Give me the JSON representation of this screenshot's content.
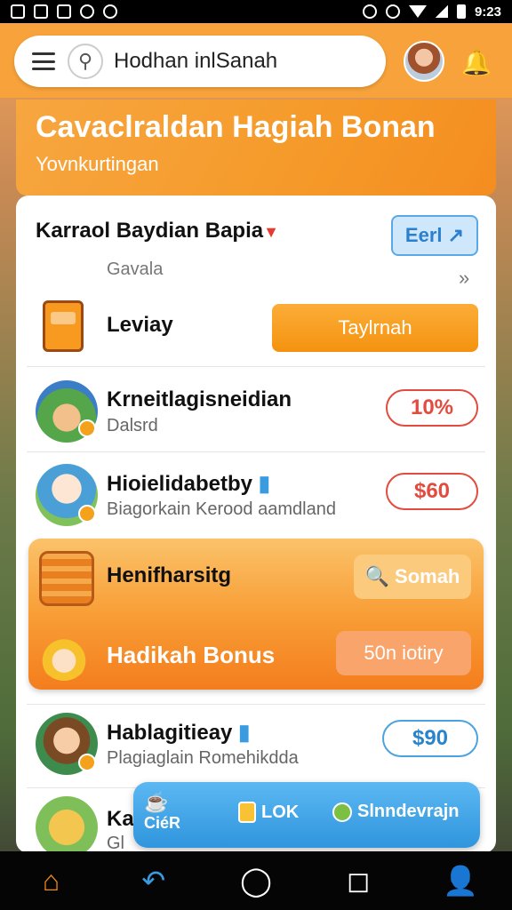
{
  "status_bar": {
    "time": "9:23"
  },
  "header": {
    "search_text": "Hodhan inlSanah"
  },
  "banner": {
    "title": "Cavaclraldan Hagiah Bonan",
    "subtitle": "Yovnkurtingan"
  },
  "card": {
    "title": "Karraol Baydian Bapia",
    "earn_label": "Eerl",
    "subtitle": "Gavala",
    "leviay_label": "Leviay",
    "action_button": "Taylrnah"
  },
  "rows": [
    {
      "title": "Krneitlagisneidian",
      "subtitle": "Dalsrd",
      "value": "10%"
    },
    {
      "title": "Hioielidabetby",
      "subtitle": "Biagorkain Kerood aamdland",
      "value": "$60"
    }
  ],
  "promo": {
    "title": "Henifharsitg",
    "button_top": "Somah",
    "bonus": "Hadikah Bonus",
    "button_bottom": "50n iotiry"
  },
  "row_after": {
    "title": "Hablagitieay",
    "subtitle": "Plagiaglain Romehikdda",
    "value": "$90"
  },
  "partial_row": {
    "title": "Ka",
    "subtitle": "Gl"
  },
  "float_bar": {
    "left_label": "CiéR",
    "mid_label": "LOK",
    "right_label": "Slnndevrajn"
  },
  "colors": {
    "brand_orange": "#f7a23b",
    "accent_blue": "#4aa3e0",
    "accent_red": "#e34b3f"
  }
}
